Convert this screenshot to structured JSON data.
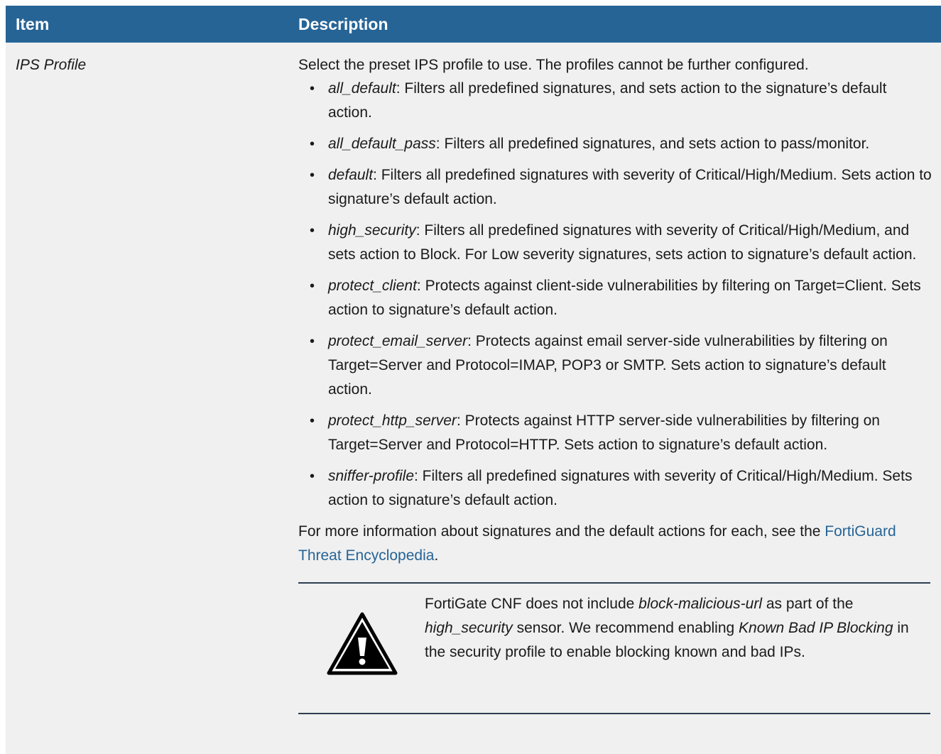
{
  "header": {
    "item": "Item",
    "description": "Description"
  },
  "row": {
    "item": "IPS Profile",
    "intro": "Select the preset IPS profile to use. The profiles cannot be further configured.",
    "bullets": [
      {
        "term": "all_default",
        "text": ": Filters all predefined signatures, and sets action to the signature’s default action."
      },
      {
        "term": "all_default_pass",
        "text": ": Filters all predefined signatures, and sets action to pass/monitor."
      },
      {
        "term": "default",
        "text": ": Filters all predefined signatures with severity of Critical/High/Medium. Sets action to signature’s default action."
      },
      {
        "term": "high_security",
        "text": ": Filters all predefined signatures with severity of Critical/High/Medium, and sets action to Block. For Low severity signatures, sets action to signature’s default action."
      },
      {
        "term": "protect_client",
        "text": ": Protects against client-side vulnerabilities by filtering on Target=Client. Sets action to signature’s default action."
      },
      {
        "term": "protect_email_server",
        "text": ": Protects against email server-side vulnerabilities by filtering on Target=Server and Protocol=IMAP, POP3 or SMTP. Sets action to signature’s default action."
      },
      {
        "term": "protect_http_server",
        "text": ": Protects against HTTP server-side vulnerabilities by filtering on Target=Server and Protocol=HTTP. Sets action to signature’s default action."
      },
      {
        "term": "sniffer-profile",
        "text": ": Filters all predefined signatures with severity of Critical/High/Medium. Sets action to signature’s default action."
      }
    ],
    "outro": "For more information about signatures and the default actions for each, see the ",
    "link": "FortiGuard Threat Encyclopedia",
    "outro_end": ".",
    "caution": {
      "p1": "FortiGate CNF does not include ",
      "i1": "block-malicious-url",
      "p2": " as part of the ",
      "i2": "high_security",
      "p3": " sensor. We recommend enabling ",
      "i3": "Known Bad IP Blocking",
      "p4": " in the security profile to enable blocking known and bad IPs."
    }
  },
  "colors": {
    "header_bg": "#266496",
    "row_bg": "#f0f0f0",
    "link": "#266496"
  }
}
